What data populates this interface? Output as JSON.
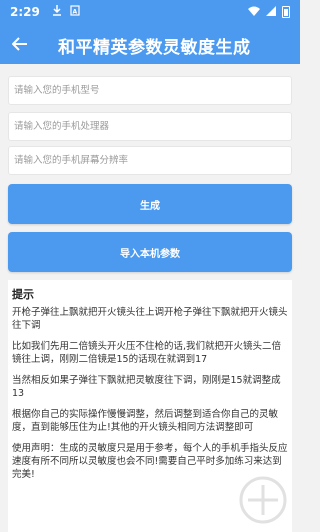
{
  "status_bar": {
    "time": "2:29",
    "icons": [
      "download-icon",
      "sim-icon"
    ],
    "right_icons": [
      "wifi-icon",
      "signal-icon",
      "battery-icon"
    ]
  },
  "app_bar": {
    "title": "和平精英参数灵敏度生成",
    "back_icon": "arrow-left-icon"
  },
  "fields": {
    "model_placeholder": "请输入您的手机型号",
    "processor_placeholder": "请输入您的手机处理器",
    "resolution_placeholder": "请输入您的手机屏幕分辨率"
  },
  "buttons": {
    "generate": "生成",
    "import": "导入本机参数"
  },
  "tips": {
    "title": "提示",
    "paragraphs": [
      "开枪子弹往上飘就把开火镜头往上调开枪子弹往下飘就把开火镜头往下调",
      "比如我们先用二倍镜头开火压不住枪的话,我们就把开火镜头二倍镜往上调，刚刚二倍镜是15的话现在就调到17",
      "当然相反如果子弹往下飘就把灵敏度往下调，刚刚是15就调整成13",
      "根据你自己的实际操作慢慢调整，然后调整到适合你自己的灵敏度，直到能够压住为止!其他的开火镜头相同方法调整即可",
      "使用声明：生成的灵敏度只是用于参考，每个人的手机手指头反应速度有所不同所以灵敏度也会不同!需要自己平时多加练习来达到完美!"
    ]
  },
  "colors": {
    "primary": "#4b9af0",
    "background": "#f2f2f2"
  }
}
